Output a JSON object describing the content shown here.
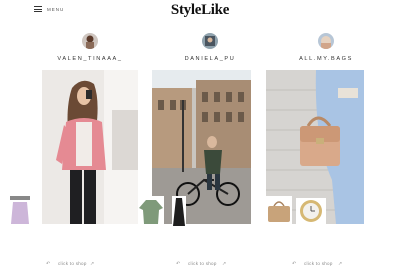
{
  "header": {
    "menu_label": "MENU",
    "logo": "StyleLike"
  },
  "posts": [
    {
      "username": "VALEN_TINAAA_",
      "shop_label": "click to shop"
    },
    {
      "username": "DANIELA_PU",
      "shop_label": "click to shop"
    },
    {
      "username": "ALL.MY.BAGS",
      "shop_label": "click to shop"
    }
  ],
  "icons": {
    "menu": "hamburger-icon",
    "shop": "pointer-arrow-icon",
    "share": "share-icon"
  }
}
